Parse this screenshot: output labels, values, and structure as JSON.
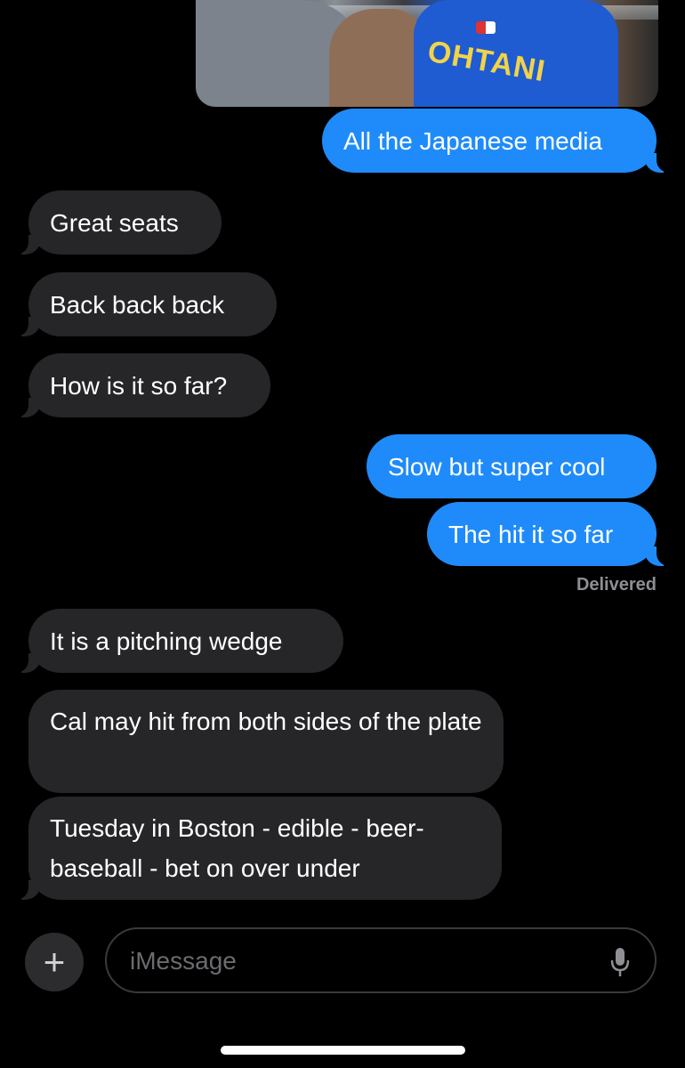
{
  "photo": {
    "jersey_text": "OHTANI"
  },
  "messages": [
    {
      "side": "sent",
      "text": "All the Japanese media"
    },
    {
      "side": "received",
      "text": "Great seats"
    },
    {
      "side": "received",
      "text": "Back back back"
    },
    {
      "side": "received",
      "text": "How is it so far?"
    },
    {
      "side": "sent",
      "text": "Slow but super cool"
    },
    {
      "side": "sent",
      "text": "The hit it so far"
    },
    {
      "side": "received",
      "text": "It is a pitching wedge"
    },
    {
      "side": "received",
      "text": "Cal may hit from both sides of the plate"
    },
    {
      "side": "received",
      "text": "Tuesday in Boston - edible - beer-baseball - bet on over under"
    }
  ],
  "status": {
    "delivered": "Delivered"
  },
  "composer": {
    "plus_symbol": "+",
    "placeholder": "iMessage",
    "icons": {
      "plus": "plus-icon",
      "mic": "microphone-icon"
    }
  },
  "colors": {
    "sent_bubble": "#1f8bfa",
    "received_bubble": "#262629",
    "background": "#000000"
  }
}
